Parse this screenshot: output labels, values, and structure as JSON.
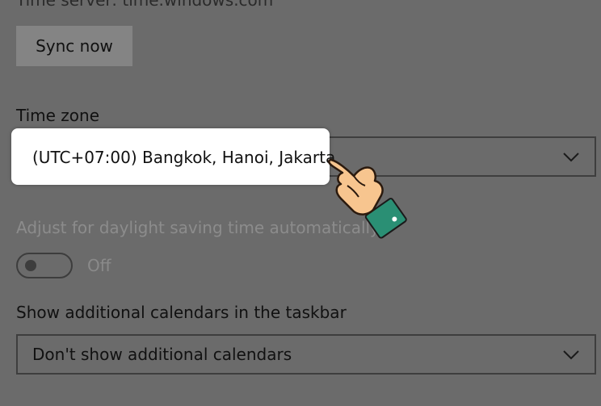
{
  "time_server": {
    "text": "Time server: time.windows.com"
  },
  "sync": {
    "label": "Sync now"
  },
  "time_zone": {
    "label": "Time zone",
    "value": "(UTC+07:00) Bangkok, Hanoi, Jakarta"
  },
  "daylight": {
    "label": "Adjust for daylight saving time automatically",
    "state": "Off"
  },
  "calendars": {
    "label": "Show additional calendars in the taskbar",
    "value": "Don't show additional calendars"
  },
  "icons": {
    "dropdown": "chevron-down-icon",
    "pointer": "hand-pointer-icon"
  }
}
